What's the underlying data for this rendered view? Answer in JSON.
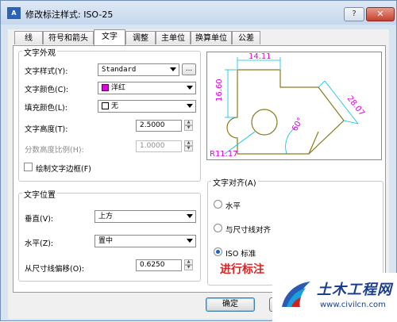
{
  "window": {
    "app_icon_text": "A",
    "title": "修改标注样式: ISO-25",
    "help_label": "?",
    "close_label": "✕"
  },
  "tabs": [
    {
      "label": "线"
    },
    {
      "label": "符号和箭头"
    },
    {
      "label": "文字",
      "active": true
    },
    {
      "label": "调整"
    },
    {
      "label": "主单位"
    },
    {
      "label": "换算单位"
    },
    {
      "label": "公差"
    }
  ],
  "appearance": {
    "title": "文字外观",
    "text_style_label": "文字样式(Y):",
    "text_style_value": "Standard",
    "browse_label": "...",
    "text_color_label": "文字颜色(C):",
    "text_color_value": "洋红",
    "text_color_hex": "#e000e0",
    "fill_color_label": "填充颜色(L):",
    "fill_color_value": "无",
    "text_height_label": "文字高度(T):",
    "text_height_value": "2.5000",
    "fraction_scale_label": "分数高度比例(H):",
    "fraction_scale_value": "1.0000",
    "draw_frame_label": "绘制文字边框(F)",
    "draw_frame_checked": false
  },
  "placement": {
    "title": "文字位置",
    "vertical_label": "垂直(V):",
    "vertical_value": "上方",
    "horizontal_label": "水平(Z):",
    "horizontal_value": "置中",
    "offset_label": "从尺寸线偏移(O):",
    "offset_value": "0.6250"
  },
  "alignment": {
    "title": "文字对齐(A)",
    "options": [
      {
        "label": "水平",
        "selected": false
      },
      {
        "label": "与尺寸线对齐",
        "selected": false
      },
      {
        "label": "ISO 标准",
        "selected": true
      }
    ]
  },
  "preview": {
    "dims": {
      "top": "14.11",
      "left": "16.60",
      "right": "28.07",
      "angle": "60°",
      "radius": "R11.17"
    },
    "line_color": "#8a7a20",
    "dim_color": "#00c0e0",
    "text_color": "#e000e0"
  },
  "buttons": {
    "ok_label": "确定"
  },
  "overlay": {
    "caption": "进行标注",
    "logo_text": "土木工程网",
    "logo_url": "www.civilcn.com"
  }
}
